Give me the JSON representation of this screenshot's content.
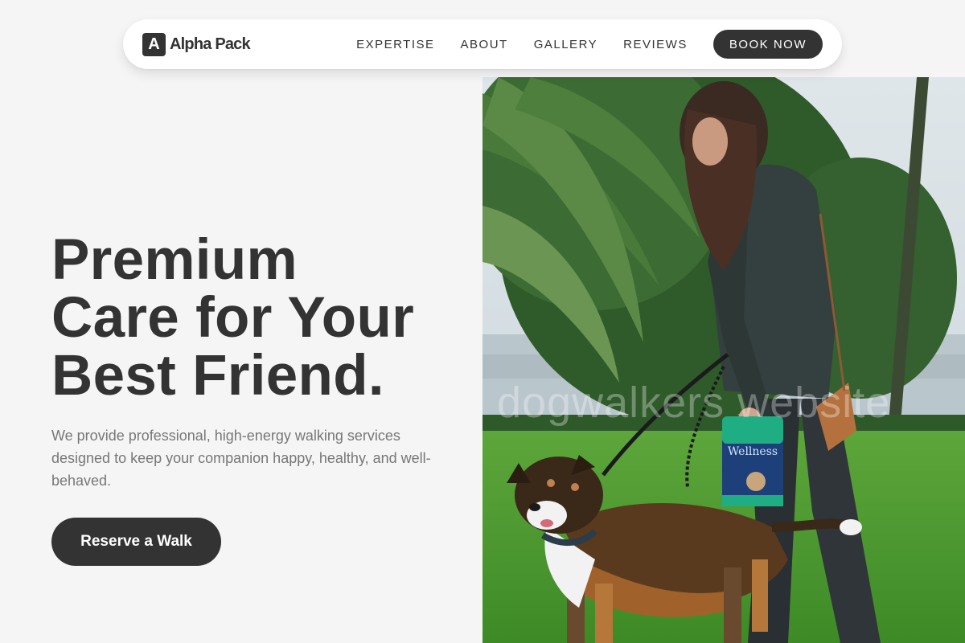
{
  "brand": {
    "logo_letter": "A",
    "name": "Alpha Pack"
  },
  "nav": {
    "links": [
      "EXPERTISE",
      "ABOUT",
      "GALLERY",
      "REVIEWS"
    ],
    "cta_label": "BOOK NOW"
  },
  "hero": {
    "headline_lines": [
      "Premium",
      "Care for Your",
      "Best Friend."
    ],
    "subtext": "We provide professional, high-energy walking services designed to keep your companion happy, healthy, and well-behaved.",
    "cta_label": "Reserve a Walk",
    "image_watermark": "dogwalkers website",
    "treat_bag_text": "Wellness"
  },
  "colors": {
    "background": "#f5f5f5",
    "text_primary": "#333333",
    "text_muted": "#777777",
    "button_dark": "#333333",
    "nav_bg": "#ffffff",
    "grass": "#4f9a35",
    "treat_bag_teal": "#1fae84"
  }
}
